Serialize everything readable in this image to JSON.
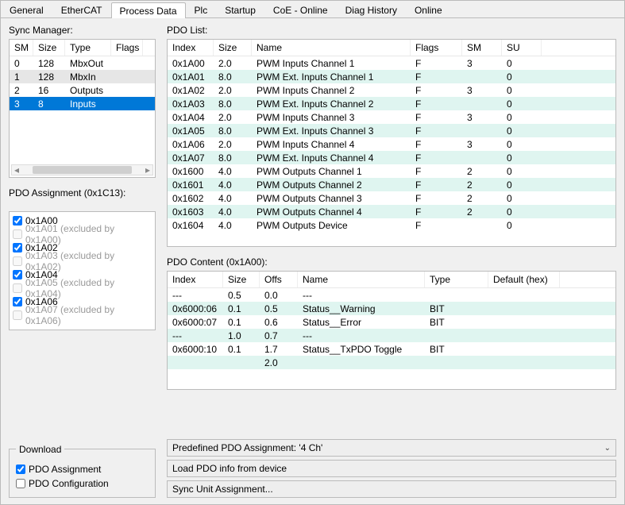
{
  "tabs": [
    "General",
    "EtherCAT",
    "Process Data",
    "Plc",
    "Startup",
    "CoE - Online",
    "Diag History",
    "Online"
  ],
  "active_tab": 2,
  "labels": {
    "sync_manager": "Sync Manager:",
    "pdo_list": "PDO List:",
    "pdo_assignment": "PDO Assignment (0x1C13):",
    "pdo_content": "PDO Content (0x1A00):",
    "download_legend": "Download"
  },
  "sync_manager": {
    "headers": [
      "SM",
      "Size",
      "Type",
      "Flags"
    ],
    "rows": [
      {
        "sm": "0",
        "size": "128",
        "type": "MbxOut",
        "flags": "",
        "select": "none"
      },
      {
        "sm": "1",
        "size": "128",
        "type": "MbxIn",
        "flags": "",
        "select": "normal"
      },
      {
        "sm": "2",
        "size": "16",
        "type": "Outputs",
        "flags": "",
        "select": "none"
      },
      {
        "sm": "3",
        "size": "8",
        "type": "Inputs",
        "flags": "",
        "select": "selected"
      }
    ]
  },
  "pdo_list": {
    "headers": [
      "Index",
      "Size",
      "Name",
      "Flags",
      "SM",
      "SU"
    ],
    "rows": [
      {
        "index": "0x1A00",
        "size": "2.0",
        "name": "PWM Inputs Channel 1",
        "flags": "F",
        "sm": "3",
        "su": "0",
        "alt": 0
      },
      {
        "index": "0x1A01",
        "size": "8.0",
        "name": "PWM Ext. Inputs Channel 1",
        "flags": "F",
        "sm": "",
        "su": "0",
        "alt": 1
      },
      {
        "index": "0x1A02",
        "size": "2.0",
        "name": "PWM Inputs Channel 2",
        "flags": "F",
        "sm": "3",
        "su": "0",
        "alt": 0
      },
      {
        "index": "0x1A03",
        "size": "8.0",
        "name": "PWM Ext. Inputs Channel 2",
        "flags": "F",
        "sm": "",
        "su": "0",
        "alt": 1
      },
      {
        "index": "0x1A04",
        "size": "2.0",
        "name": "PWM Inputs Channel 3",
        "flags": "F",
        "sm": "3",
        "su": "0",
        "alt": 0
      },
      {
        "index": "0x1A05",
        "size": "8.0",
        "name": "PWM Ext. Inputs Channel 3",
        "flags": "F",
        "sm": "",
        "su": "0",
        "alt": 1
      },
      {
        "index": "0x1A06",
        "size": "2.0",
        "name": "PWM Inputs Channel 4",
        "flags": "F",
        "sm": "3",
        "su": "0",
        "alt": 0
      },
      {
        "index": "0x1A07",
        "size": "8.0",
        "name": "PWM Ext. Inputs Channel 4",
        "flags": "F",
        "sm": "",
        "su": "0",
        "alt": 1
      },
      {
        "index": "0x1600",
        "size": "4.0",
        "name": "PWM Outputs Channel 1",
        "flags": "F",
        "sm": "2",
        "su": "0",
        "alt": 0
      },
      {
        "index": "0x1601",
        "size": "4.0",
        "name": "PWM Outputs Channel 2",
        "flags": "F",
        "sm": "2",
        "su": "0",
        "alt": 1
      },
      {
        "index": "0x1602",
        "size": "4.0",
        "name": "PWM Outputs Channel 3",
        "flags": "F",
        "sm": "2",
        "su": "0",
        "alt": 0
      },
      {
        "index": "0x1603",
        "size": "4.0",
        "name": "PWM Outputs Channel 4",
        "flags": "F",
        "sm": "2",
        "su": "0",
        "alt": 1
      },
      {
        "index": "0x1604",
        "size": "4.0",
        "name": "PWM Outputs Device",
        "flags": "F",
        "sm": "",
        "su": "0",
        "alt": 0
      }
    ]
  },
  "pdo_assignment": [
    {
      "label": "0x1A00",
      "checked": true,
      "excluded": false,
      "excl_text": ""
    },
    {
      "label": "0x1A01",
      "checked": false,
      "excluded": true,
      "excl_text": " (excluded by 0x1A00)"
    },
    {
      "label": "0x1A02",
      "checked": true,
      "excluded": false,
      "excl_text": ""
    },
    {
      "label": "0x1A03",
      "checked": false,
      "excluded": true,
      "excl_text": " (excluded by 0x1A02)"
    },
    {
      "label": "0x1A04",
      "checked": true,
      "excluded": false,
      "excl_text": ""
    },
    {
      "label": "0x1A05",
      "checked": false,
      "excluded": true,
      "excl_text": " (excluded by 0x1A04)"
    },
    {
      "label": "0x1A06",
      "checked": true,
      "excluded": false,
      "excl_text": ""
    },
    {
      "label": "0x1A07",
      "checked": false,
      "excluded": true,
      "excl_text": " (excluded by 0x1A06)"
    }
  ],
  "pdo_content": {
    "headers": [
      "Index",
      "Size",
      "Offs",
      "Name",
      "Type",
      "Default (hex)"
    ],
    "rows": [
      {
        "index": "---",
        "size": "0.5",
        "offs": "0.0",
        "name": "---",
        "type": "",
        "def": "",
        "alt": 0
      },
      {
        "index": "0x6000:06",
        "size": "0.1",
        "offs": "0.5",
        "name": "Status__Warning",
        "type": "BIT",
        "def": "",
        "alt": 1
      },
      {
        "index": "0x6000:07",
        "size": "0.1",
        "offs": "0.6",
        "name": "Status__Error",
        "type": "BIT",
        "def": "",
        "alt": 0
      },
      {
        "index": "---",
        "size": "1.0",
        "offs": "0.7",
        "name": "---",
        "type": "",
        "def": "",
        "alt": 1
      },
      {
        "index": "0x6000:10",
        "size": "0.1",
        "offs": "1.7",
        "name": "Status__TxPDO Toggle",
        "type": "BIT",
        "def": "",
        "alt": 0
      },
      {
        "index": "",
        "size": "",
        "offs": "2.0",
        "name": "",
        "type": "",
        "def": "",
        "alt": 1
      }
    ]
  },
  "download": {
    "pdo_assignment_label": "PDO Assignment",
    "pdo_assignment_checked": true,
    "pdo_configuration_label": "PDO Configuration",
    "pdo_configuration_checked": false
  },
  "actions": {
    "predefined": "Predefined PDO Assignment: '4 Ch'",
    "load_from_device": "Load PDO info from device",
    "sync_unit": "Sync Unit Assignment..."
  }
}
